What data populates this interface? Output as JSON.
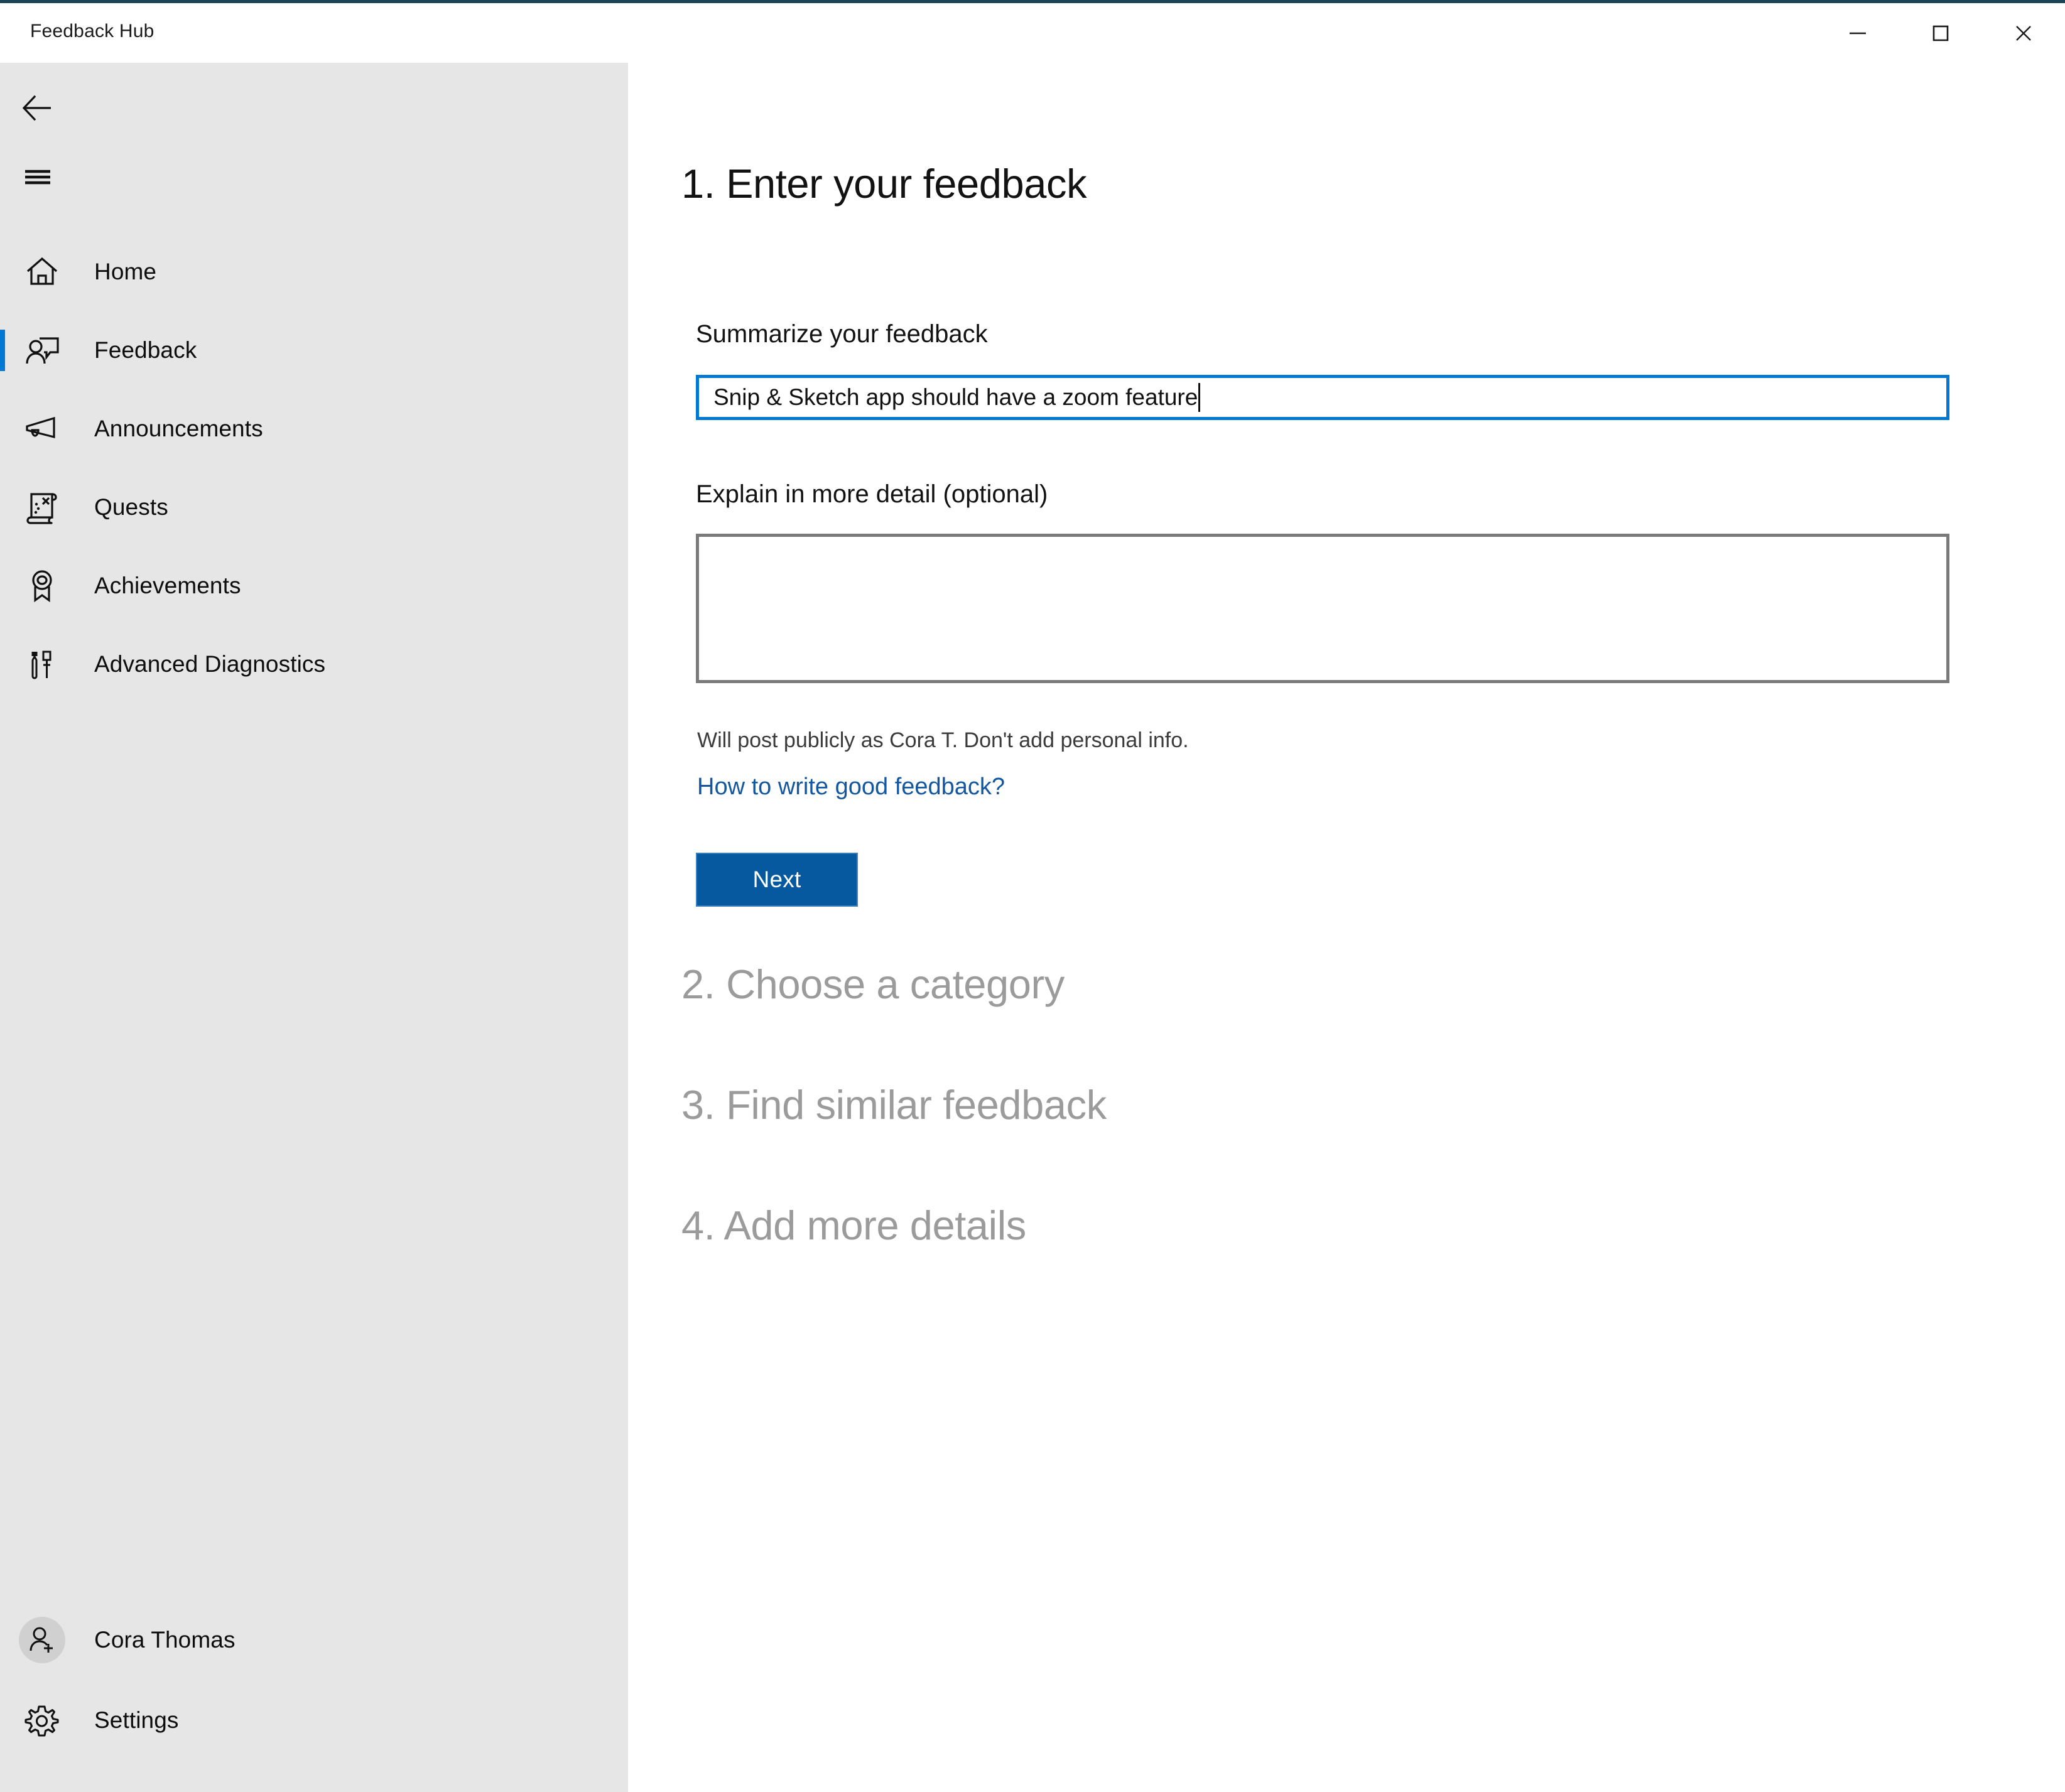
{
  "window": {
    "title": "Feedback Hub",
    "accent_line_color": "#1c4458",
    "controls": {
      "minimize": "minimize-button",
      "maximize": "maximize-button",
      "close": "close-button"
    }
  },
  "sidebar": {
    "background": "#e6e6e6",
    "selection_color": "#0078d4",
    "back_label": "Back",
    "menu_label": "Navigation menu",
    "items": [
      {
        "label": "Home",
        "icon": "home-icon",
        "selected": false
      },
      {
        "label": "Feedback",
        "icon": "feedback-icon",
        "selected": true
      },
      {
        "label": "Announcements",
        "icon": "megaphone-icon",
        "selected": false
      },
      {
        "label": "Quests",
        "icon": "scroll-map-icon",
        "selected": false
      },
      {
        "label": "Achievements",
        "icon": "award-ribbon-icon",
        "selected": false
      },
      {
        "label": "Advanced Diagnostics",
        "icon": "tools-icon",
        "selected": false
      }
    ],
    "account": {
      "name": "Cora Thomas",
      "icon": "person-add-icon"
    },
    "settings": {
      "label": "Settings",
      "icon": "gear-icon"
    }
  },
  "main": {
    "step1": {
      "heading": "1. Enter your feedback",
      "summary_label": "Summarize your feedback",
      "summary_value": "Snip & Sketch app should have a zoom feature",
      "summary_placeholder": "",
      "detail_label": "Explain in more detail (optional)",
      "detail_value": "",
      "detail_placeholder": "",
      "privacy_note": "Will post publicly as Cora T. Don't add personal info.",
      "help_link": "How to write good feedback?",
      "next_label": "Next",
      "next_color": "#06599f",
      "link_color": "#1257a0",
      "focus_border_color": "#0078d4"
    },
    "step2_heading": "2. Choose a category",
    "step3_heading": "3. Find similar feedback",
    "step4_heading": "4. Add more details",
    "dim_color": "#9b9b9b"
  }
}
